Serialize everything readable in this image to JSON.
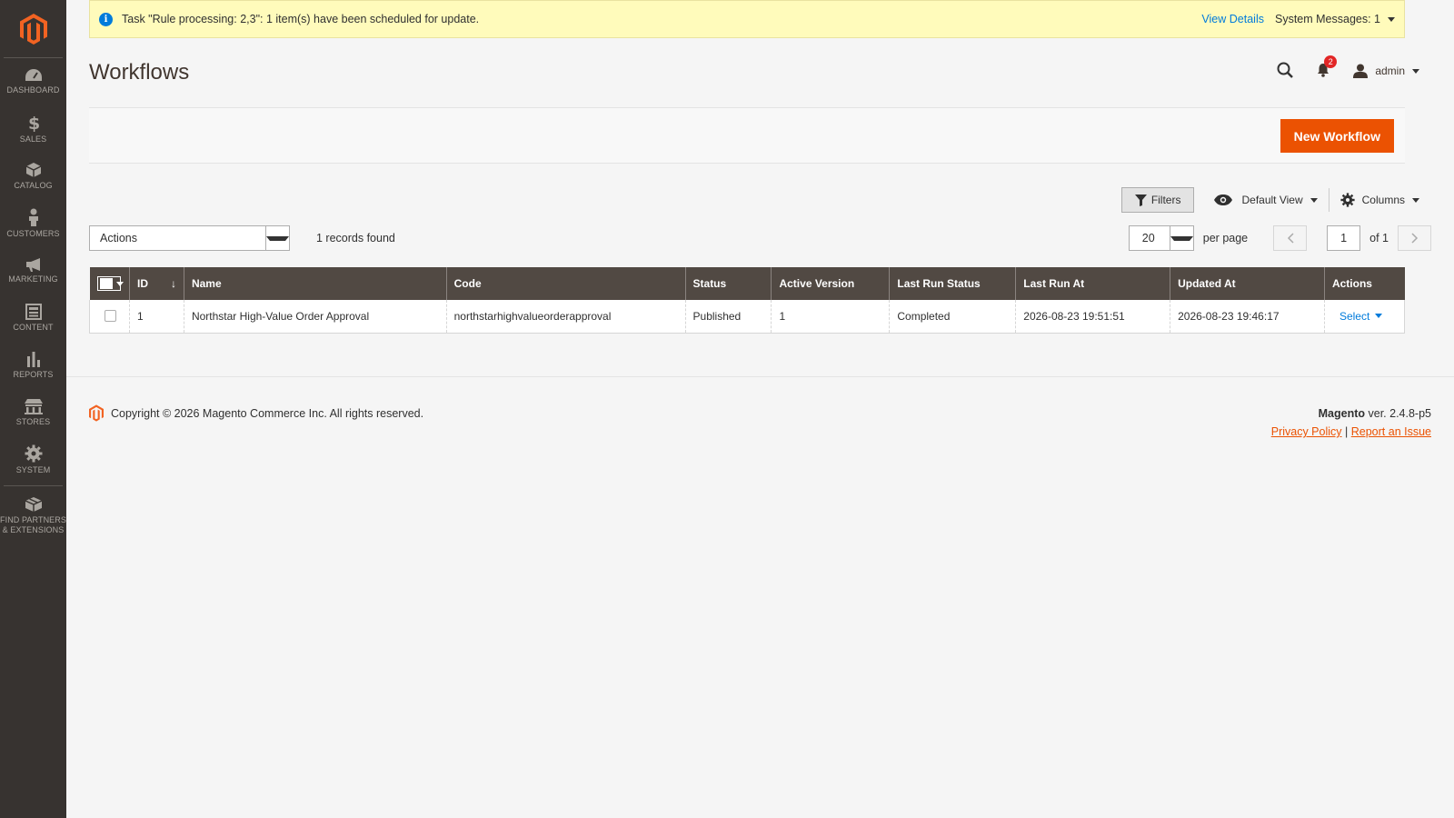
{
  "sidebar": {
    "items": [
      {
        "label": "DASHBOARD",
        "icon": "dashboard-icon"
      },
      {
        "label": "SALES",
        "icon": "dollar-icon"
      },
      {
        "label": "CATALOG",
        "icon": "cube-icon"
      },
      {
        "label": "CUSTOMERS",
        "icon": "person-icon"
      },
      {
        "label": "MARKETING",
        "icon": "megaphone-icon"
      },
      {
        "label": "CONTENT",
        "icon": "layout-icon"
      },
      {
        "label": "REPORTS",
        "icon": "bar-chart-icon"
      },
      {
        "label": "STORES",
        "icon": "store-icon"
      },
      {
        "label": "SYSTEM",
        "icon": "gear-icon"
      }
    ],
    "extensions_label_1": "FIND PARTNERS",
    "extensions_label_2": "& EXTENSIONS"
  },
  "message": {
    "text": "Task \"Rule processing: 2,3\": 1 item(s) have been scheduled for update.",
    "view_details": "View Details",
    "system_messages": "System Messages: 1"
  },
  "header": {
    "title": "Workflows",
    "notification_count": "2",
    "user": "admin"
  },
  "actionbar": {
    "new_button": "New Workflow"
  },
  "grid_tools": {
    "filters": "Filters",
    "view": "Default View",
    "columns": "Columns"
  },
  "mass_actions": {
    "label": "Actions"
  },
  "records_found": "1 records found",
  "pager": {
    "per_page_value": "20",
    "per_page_label": "per page",
    "current_page": "1",
    "of_pages": "of 1"
  },
  "table": {
    "headers": [
      "ID",
      "Name",
      "Code",
      "Status",
      "Active Version",
      "Last Run Status",
      "Last Run At",
      "Updated At",
      "Actions"
    ],
    "sort_indicator": "↓",
    "rows": [
      {
        "id": "1",
        "name": "Northstar High-Value Order Approval",
        "code": "northstarhighvalueorderapproval",
        "status": "Published",
        "active_version": "1",
        "last_run_status": "Completed",
        "last_run_at": "2026-08-23 19:51:51",
        "updated_at": "2026-08-23 19:46:17",
        "action": "Select"
      }
    ]
  },
  "footer": {
    "copyright": "Copyright © 2026 Magento Commerce Inc. All rights reserved.",
    "brand": "Magento",
    "version": "ver. 2.4.8-p5",
    "privacy": "Privacy Policy",
    "separator": "|",
    "report": "Report an Issue"
  },
  "colors": {
    "accent": "#eb5202",
    "sidebar": "#373330",
    "table_header": "#514943",
    "link": "#007bdb",
    "message_bg": "#fffbbb"
  }
}
